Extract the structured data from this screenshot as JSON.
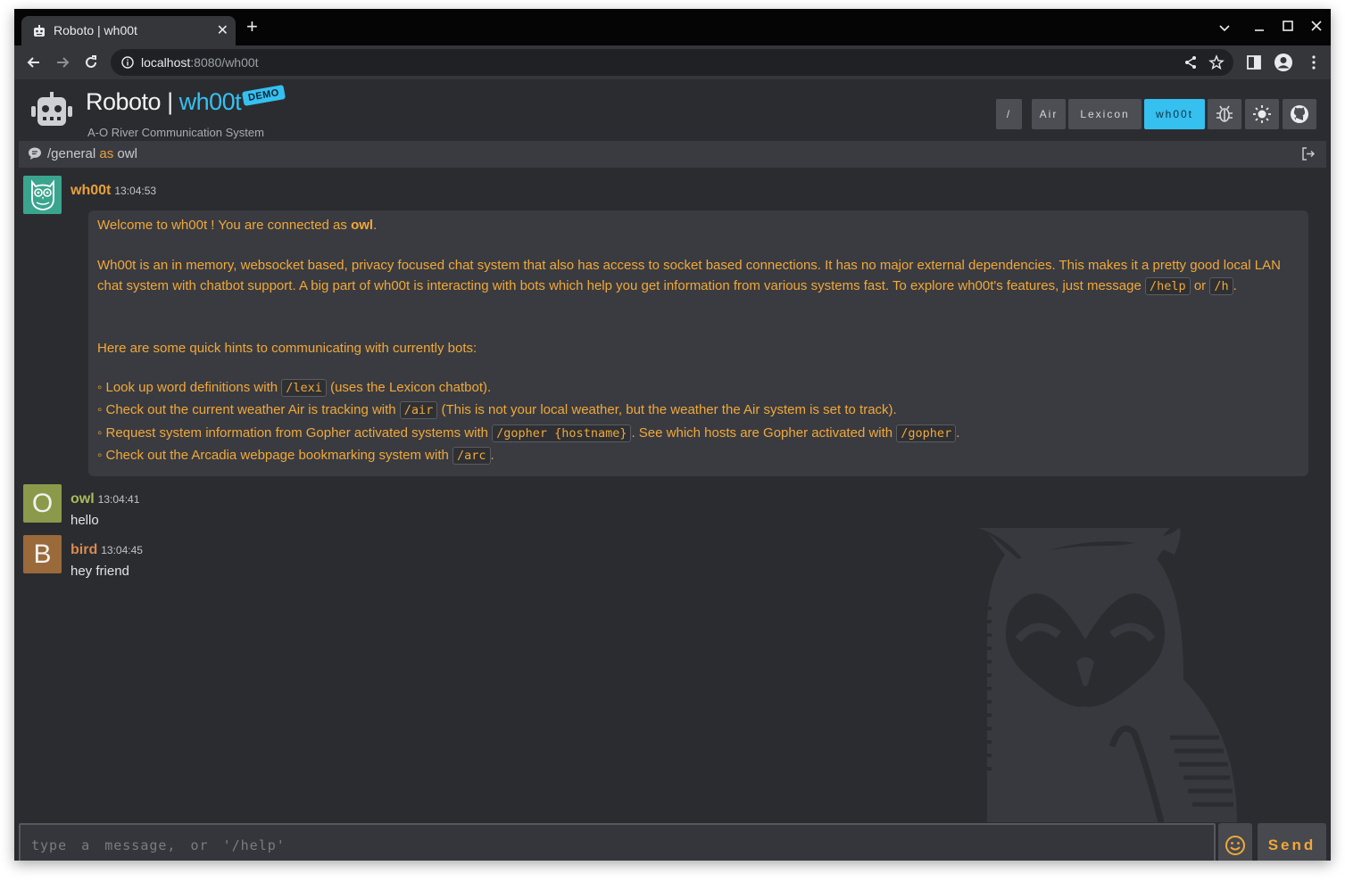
{
  "browser": {
    "tab_title": "Roboto | wh00t",
    "tab_close": "✕",
    "new_tab": "+",
    "url_host": "localhost",
    "url_path": ":8080/wh00t"
  },
  "header": {
    "brand": "Roboto | ",
    "brand_accent": "wh00t",
    "badge": "DEMO",
    "subtitle": "A-O River Communication System",
    "nav": [
      {
        "label": "/"
      },
      {
        "label": "Air"
      },
      {
        "label": "Lexicon"
      },
      {
        "label": "wh00t",
        "active": true
      }
    ],
    "icons": [
      "bug-icon",
      "sun-icon",
      "github-icon"
    ]
  },
  "channel": {
    "name": "/general",
    "as_word": "as",
    "user": "owl"
  },
  "messages": [
    {
      "author": "wh00t",
      "time": "13:04:53",
      "avatar_color": "#3aa58e",
      "name_color": "#e8a13a",
      "welcome_pre": "Welcome to wh00t ! You are connected as ",
      "welcome_user": "owl",
      "welcome_post": ".",
      "para1": "Wh00t is an in memory, websocket based, privacy focused chat system that also has access to socket based connections.  It has no major external dependencies.  This makes it a pretty good local LAN chat system with chatbot support.  A big part of wh00t is interacting with bots which help you get information from various systems fast. To explore wh00t's features, just message",
      "help_cmd": "/help",
      "or_word": "or",
      "h_cmd": "/h",
      "para_end": ".",
      "hints_intro": "Here are some quick hints to communicating with currently bots:",
      "hint1_pre": "◦ Look up word definitions with ",
      "hint1_cmd": "/lexi",
      "hint1_post": " (uses the Lexicon chatbot).",
      "hint2_pre": "◦ Check out the current weather Air is tracking with ",
      "hint2_cmd": "/air",
      "hint2_post": " (This is not your local weather, but the weather the Air system is set to track).",
      "hint3_pre": "◦ Request system information from Gopher activated systems with ",
      "hint3_cmd": "/gopher {hostname}",
      "hint3_mid": ". See which hosts are Gopher activated with ",
      "hint3_cmd2": "/gopher",
      "hint3_post": ".",
      "hint4_pre": "◦ Check out the Arcadia webpage bookmarking system with ",
      "hint4_cmd": "/arc",
      "hint4_post": "."
    },
    {
      "author": "owl",
      "time": "13:04:41",
      "avatar_letter": "O",
      "avatar_color": "#8a9a4a",
      "name_color": "#a9bb5a",
      "text": "hello"
    },
    {
      "author": "bird",
      "time": "13:04:45",
      "avatar_letter": "B",
      "avatar_color": "#9a6a3a",
      "name_color": "#d98a50",
      "text": "hey friend"
    }
  ],
  "composer": {
    "placeholder": "type a message, or '/help'",
    "send_label": "Send"
  },
  "colors": {
    "accent": "#35c0f0",
    "orange": "#f0a83a",
    "background": "#2b2c30"
  }
}
